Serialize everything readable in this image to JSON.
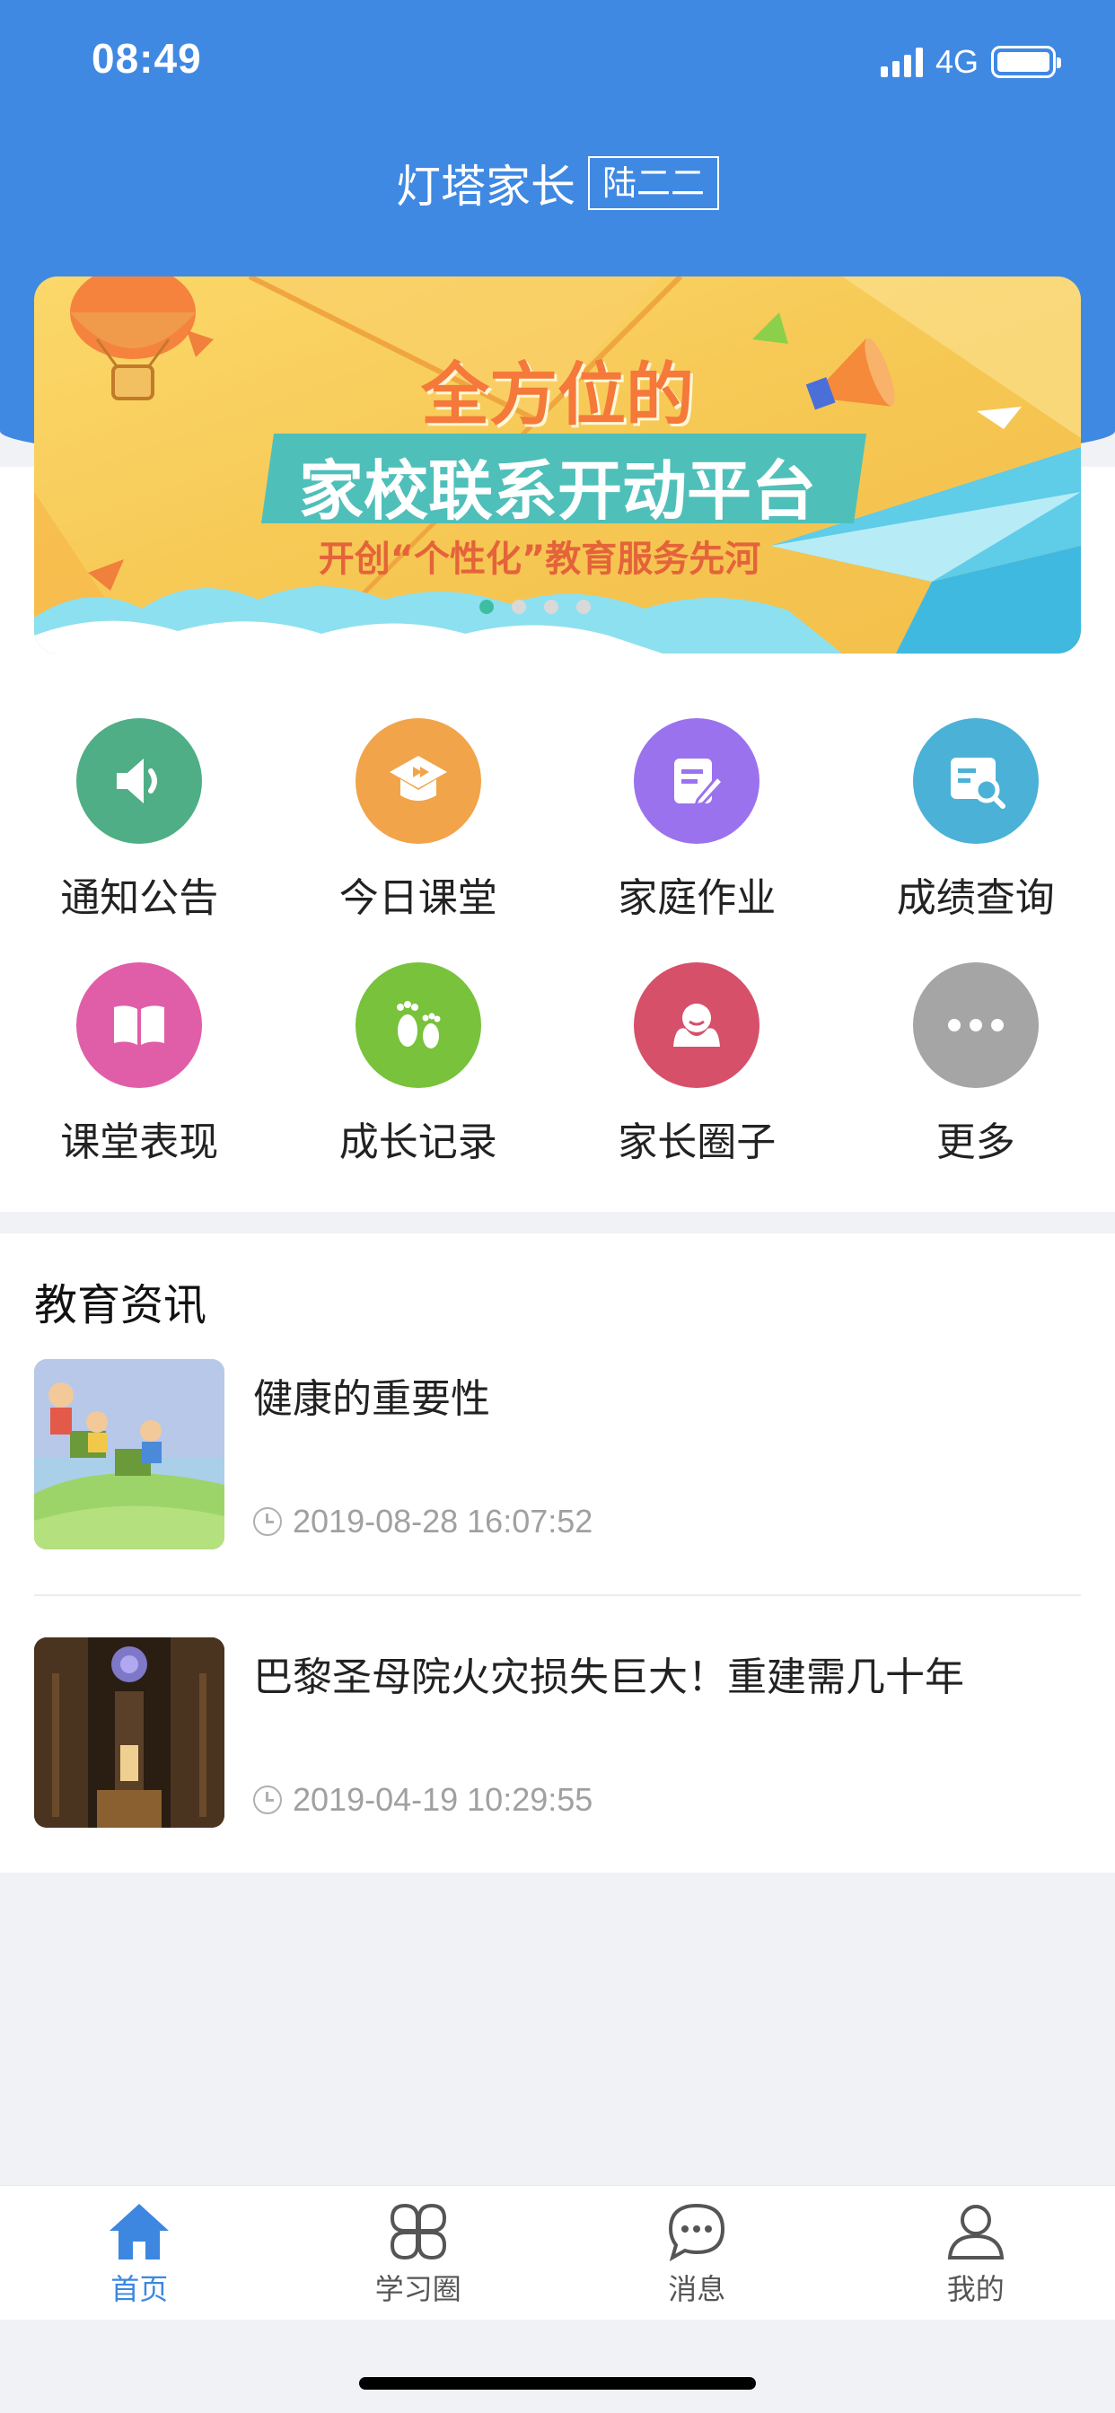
{
  "status_bar": {
    "time": "08:49",
    "network": "4G"
  },
  "header": {
    "title": "灯塔家长",
    "child_name": "陆二二"
  },
  "banner": {
    "line1": "全方位的",
    "line2": "家校联系开动平台",
    "line3": "开创“个性化”教育服务先河",
    "dots": 4,
    "active_dot": 0
  },
  "features": [
    {
      "label": "通知公告",
      "icon": "speaker-icon",
      "color": "#4fae86"
    },
    {
      "label": "今日课堂",
      "icon": "graduation-cap-icon",
      "color": "#f2a44a"
    },
    {
      "label": "家庭作业",
      "icon": "homework-icon",
      "color": "#9b72ee"
    },
    {
      "label": "成绩查询",
      "icon": "search-grades-icon",
      "color": "#4cb1d7"
    },
    {
      "label": "课堂表现",
      "icon": "book-icon",
      "color": "#e05ea8"
    },
    {
      "label": "成长记录",
      "icon": "footprints-icon",
      "color": "#78c23c"
    },
    {
      "label": "家长圈子",
      "icon": "people-icon",
      "color": "#d6506a"
    },
    {
      "label": "更多",
      "icon": "more-icon",
      "color": "#a5a5a5"
    }
  ],
  "news": {
    "heading": "教育资讯",
    "items": [
      {
        "title": "健康的重要性",
        "time": "2019-08-28 16:07:52"
      },
      {
        "title": "巴黎圣母院火灾损失巨大！重建需几十年",
        "time": "2019-04-19 10:29:55"
      }
    ]
  },
  "tabbar": {
    "items": [
      {
        "label": "首页",
        "icon": "home-icon"
      },
      {
        "label": "学习圈",
        "icon": "apps-icon"
      },
      {
        "label": "消息",
        "icon": "chat-icon"
      },
      {
        "label": "我的",
        "icon": "profile-icon"
      }
    ],
    "active_index": 0
  },
  "colors": {
    "primary": "#4089e3",
    "active_tab": "#3d87e0"
  }
}
